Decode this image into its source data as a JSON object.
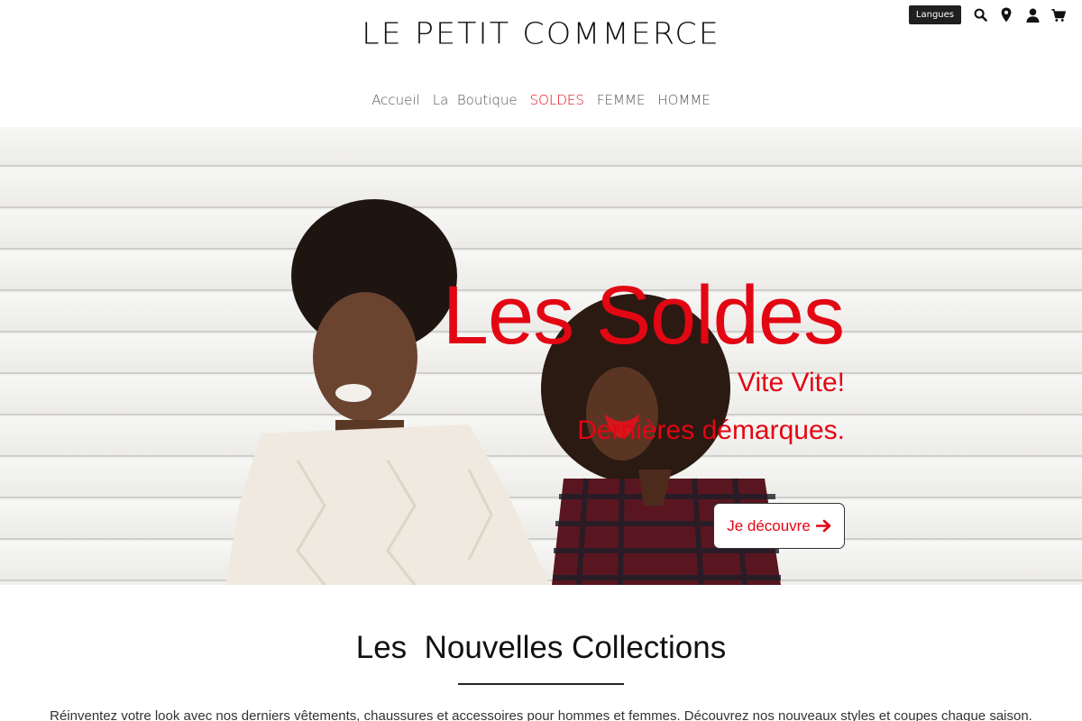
{
  "brand": {
    "logo_text": "LE PETIT COMMERCE"
  },
  "utility": {
    "language_label": "Langues",
    "icons": [
      "search-icon",
      "location-pin-icon",
      "user-icon",
      "cart-icon"
    ]
  },
  "nav": {
    "items": [
      {
        "label": "Accueil"
      },
      {
        "label": "La  Boutique"
      },
      {
        "label": "SOLDES"
      },
      {
        "label": "FEMME"
      },
      {
        "label": "HOMME"
      }
    ],
    "accent_color": "#e30613"
  },
  "hero": {
    "title": "Les Soldes",
    "subtitle_1": "Vite Vite!",
    "subtitle_2": "Dernières démarques.",
    "cta_label": "Je découvre",
    "cta_icon": "arrow-right-icon",
    "text_color": "#e30613"
  },
  "collections": {
    "title": "Les  Nouvelles Collections",
    "description": "Réinventez votre look avec nos derniers vêtements, chaussures et accessoires pour hommes et femmes.  Découvrez nos nouveaux styles et coupes chaque saison."
  }
}
